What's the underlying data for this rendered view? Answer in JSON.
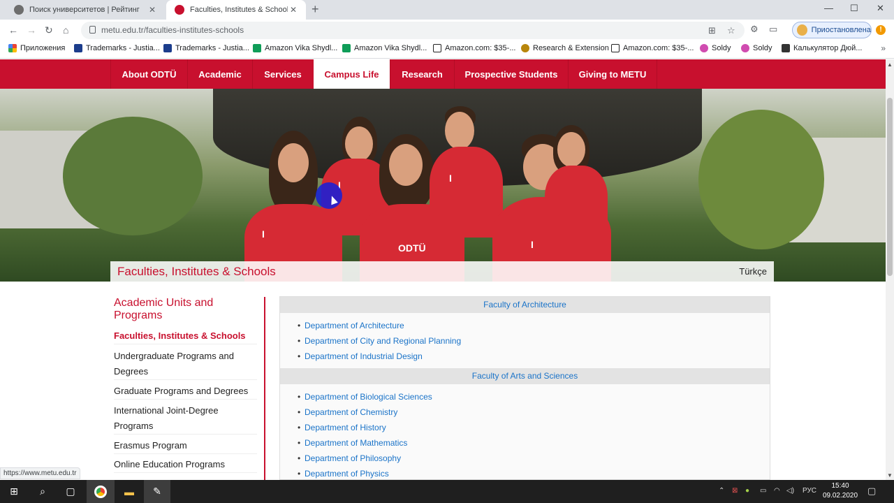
{
  "browser": {
    "tabs": [
      {
        "title": "Поиск университетов | Рейтинг",
        "active": false
      },
      {
        "title": "Faculties, Institutes & Schools | M",
        "active": true
      }
    ],
    "url": "metu.edu.tr/faculties-institutes-schools",
    "profile_label": "Приостановлена",
    "bookmarks": [
      "Приложения",
      "Trademarks - Justia...",
      "Trademarks - Justia...",
      "Amazon Vika Shydl...",
      "Amazon Vika Shydl...",
      "Amazon.com: $35-...",
      "Research & Extension",
      "Amazon.com: $35-...",
      "Soldy",
      "Soldy",
      "Калькулятор Дюй..."
    ],
    "status_url": "https://www.metu.edu.tr"
  },
  "nav": {
    "items": [
      "About ODTÜ",
      "Academic",
      "Services",
      "Campus Life",
      "Research",
      "Prospective Students",
      "Giving to METU"
    ],
    "active_index": 3
  },
  "hero": {
    "title": "Faculties, Institutes & Schools",
    "language_link": "Türkçe",
    "shirt_text_1": "I",
    "shirt_text_2": "ODTÜ"
  },
  "sidebar": {
    "heading": "Academic Units and Programs",
    "links": [
      "Faculties, Institutes & Schools",
      "Undergraduate Programs and Degrees",
      "Graduate Programs and Degrees",
      "International Joint-Degree Programs",
      "Erasmus Program",
      "Online Education Programs"
    ]
  },
  "faculties": [
    {
      "name": "Faculty of Architecture",
      "departments": [
        "Department of Architecture",
        "Department of City and Regional Planning",
        "Department of Industrial Design"
      ]
    },
    {
      "name": "Faculty of Arts and Sciences",
      "departments": [
        "Department of Biological Sciences",
        "Department of Chemistry",
        "Department of History",
        "Department of Mathematics",
        "Department of Philosophy",
        "Department of Physics"
      ]
    }
  ],
  "taskbar": {
    "time": "15:40",
    "date": "09.02.2020",
    "lang": "РУС"
  },
  "colors": {
    "brand_red": "#c8102e",
    "link_blue": "#1a73c8"
  }
}
